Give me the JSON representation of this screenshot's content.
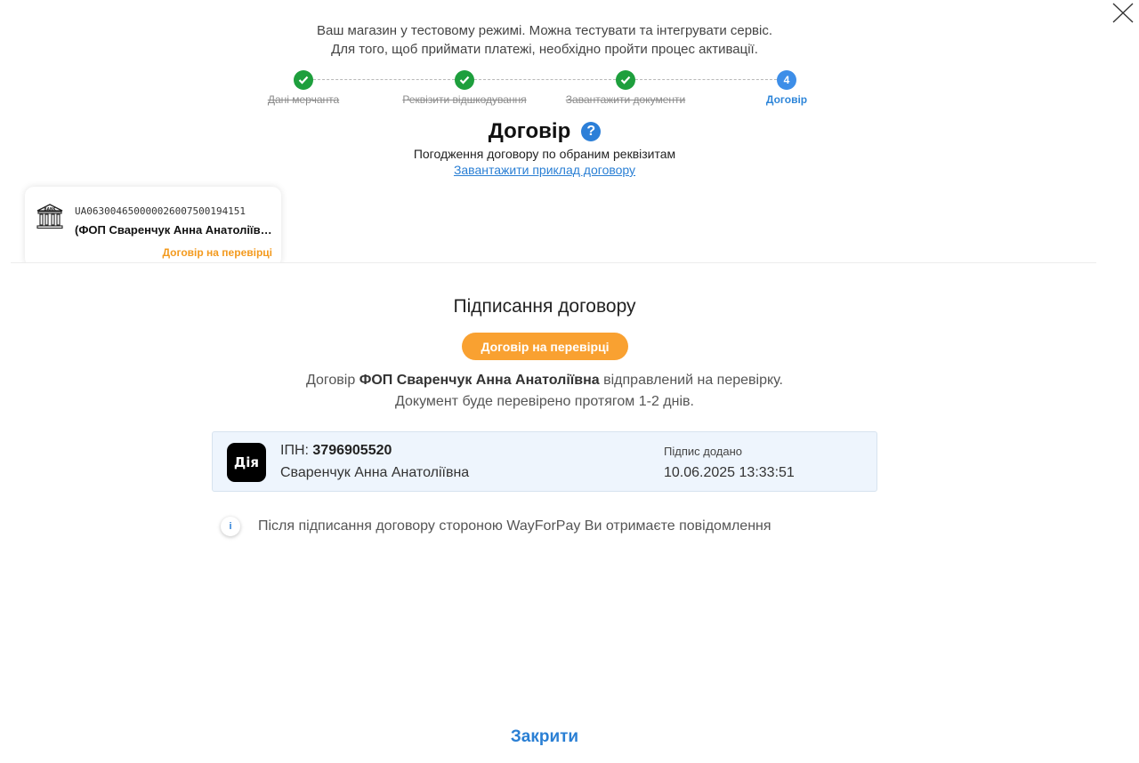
{
  "notice": {
    "line1": "Ваш магазин у тестовому режимі. Можна тестувати та інтегрувати сервіс.",
    "line2": "Для того, щоб приймати платежі, необхідно пройти процес активації."
  },
  "steps": [
    {
      "label": "Дані мерчанта",
      "status": "done"
    },
    {
      "label": "Реквізити відшкодування",
      "status": "done"
    },
    {
      "label": "Завантажити документи",
      "status": "done"
    },
    {
      "label": "Договір",
      "status": "active",
      "number": "4"
    }
  ],
  "header": {
    "title": "Договір",
    "help_symbol": "?",
    "subtitle": "Погодження договору по обраним реквізитам",
    "sample_link": "Завантажити приклад договору"
  },
  "account_card": {
    "iban": "UA063004650000026007500194151",
    "owner": "(ФОП Сваренчук Анна Анатоліївна)",
    "status": "Договір на перевірці",
    "bank_icon_text": "BANK"
  },
  "signing": {
    "title": "Підписання договору",
    "status_pill": "Договір на перевірці",
    "text_prefix": "Договір",
    "text_name": "ФОП Сваренчук Анна Анатоліївна",
    "text_suffix": "відправлений на перевірку.",
    "text_line2": "Документ буде перевірено протягом 1-2 днів."
  },
  "signature": {
    "logo_text": "Дія",
    "ipn_label": "ІПН:",
    "ipn_value": "3796905520",
    "signer": "Сваренчук Анна Анатоліївна",
    "added_label": "Підпис додано",
    "added_date": "10.06.2025 13:33:51"
  },
  "info": {
    "icon_symbol": "i",
    "text": "Після підписання договору стороною WayForPay Ви отримаєте повідомлення"
  },
  "footer": {
    "close_label": "Закрити"
  },
  "colors": {
    "done": "#1e9f3d",
    "active": "#3d8ee8",
    "accent": "#f9a131",
    "link": "#2a7fd4"
  }
}
